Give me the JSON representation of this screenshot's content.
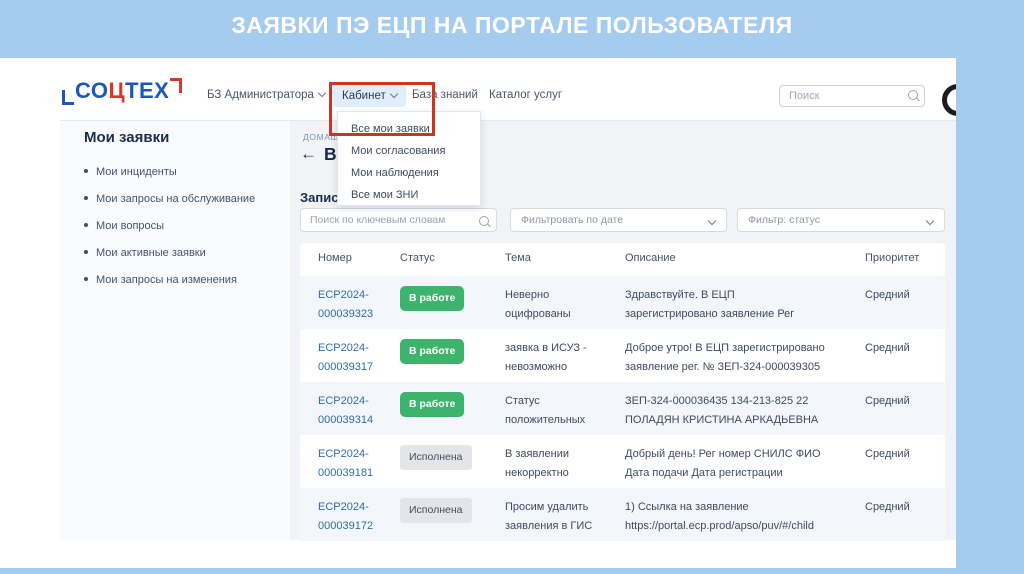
{
  "slide": {
    "title": "ЗАЯВКИ ПЭ ЕЦП НА ПОРТАЛЕ ПОЛЬЗОВАТЕЛЯ"
  },
  "portal": {
    "logo": {
      "text_left": "СО",
      "text_mid": "Ц",
      "text_right": "ТЕХ"
    },
    "nav": {
      "admin": "БЗ Администратора",
      "cabinet": "Кабинет",
      "knowledge_base": "База знаний",
      "service_catalog": "Каталог услуг"
    },
    "top_search_placeholder": "Поиск",
    "cabinet_menu": [
      "Все мои заявки",
      "Мои согласования",
      "Мои наблюдения",
      "Все мои ЗНИ"
    ],
    "sidebar": {
      "title": "Мои заявки",
      "items": [
        "Мои инциденты",
        "Мои запросы на обслуживание",
        "Мои вопросы",
        "Мои активные заявки",
        "Мои запросы на изменения"
      ]
    },
    "content": {
      "breadcrumb": "ДОМАШ",
      "back_arrow": "←",
      "heading_visible": "В",
      "records_label": "Запис",
      "filters": {
        "keyword_placeholder": "Поиск по ключевым словам",
        "date_filter": "Фильтровать по дате",
        "status_filter": "Фильтр: статус"
      }
    },
    "table": {
      "columns": [
        "Номер",
        "Статус",
        "Тема",
        "Описание",
        "Приоритет"
      ],
      "rows": [
        {
          "number_line1": "ECP2024-",
          "number_line2": "000039323",
          "status": "В работе",
          "status_style": "green",
          "subject_line1": "Неверно",
          "subject_line2": "оцифрованы",
          "description_line1": "Здравствуйте. В ЕЦП",
          "description_line2": "зарегистрировано заявление Рег",
          "priority": "Средний"
        },
        {
          "number_line1": "ECP2024-",
          "number_line2": "000039317",
          "status": "В работе",
          "status_style": "green",
          "subject_line1": "заявка в ИСУЗ -",
          "subject_line2": "невозможно",
          "description_line1": "Доброе утро! В ЕЦП зарегистрировано",
          "description_line2": "заявление рег. № ЗЕП-324-000039305",
          "priority": "Средний"
        },
        {
          "number_line1": "ECP2024-",
          "number_line2": "000039314",
          "status": "В работе",
          "status_style": "green",
          "subject_line1": "Статус",
          "subject_line2": "положительных",
          "description_line1": "ЗЕП-324-000036435 134-213-825 22",
          "description_line2": "ПОЛАДЯН КРИСТИНА АРКАДЬЕВНА",
          "priority": "Средний"
        },
        {
          "number_line1": "ECP2024-",
          "number_line2": "000039181",
          "status": "Исполнена",
          "status_style": "gray",
          "subject_line1": "В заявлении",
          "subject_line2": "некорректно",
          "description_line1": "Добрый день! Рег номер СНИЛС ФИО",
          "description_line2": "Дата подачи Дата регистрации",
          "priority": "Средний"
        },
        {
          "number_line1": "ECP2024-",
          "number_line2": "000039172",
          "status": "Исполнена",
          "status_style": "gray",
          "subject_line1": "Просим удалить",
          "subject_line2": "заявления в ГИС",
          "description_line1": "1) Ссылка на заявление",
          "description_line2": "https://portal.ecp.prod/apso/puv/#/child",
          "priority": "Средний"
        }
      ]
    }
  },
  "colors": {
    "banner_blue": "#a5cbee",
    "logo_blue": "#1b58b9",
    "logo_red": "#d6382e",
    "badge_green": "#3cb46e",
    "badge_gray": "#e3e5e9",
    "link_blue": "#2e6ca8",
    "annotation_red": "#cf3328",
    "main_bg": "#f1f3f6"
  }
}
